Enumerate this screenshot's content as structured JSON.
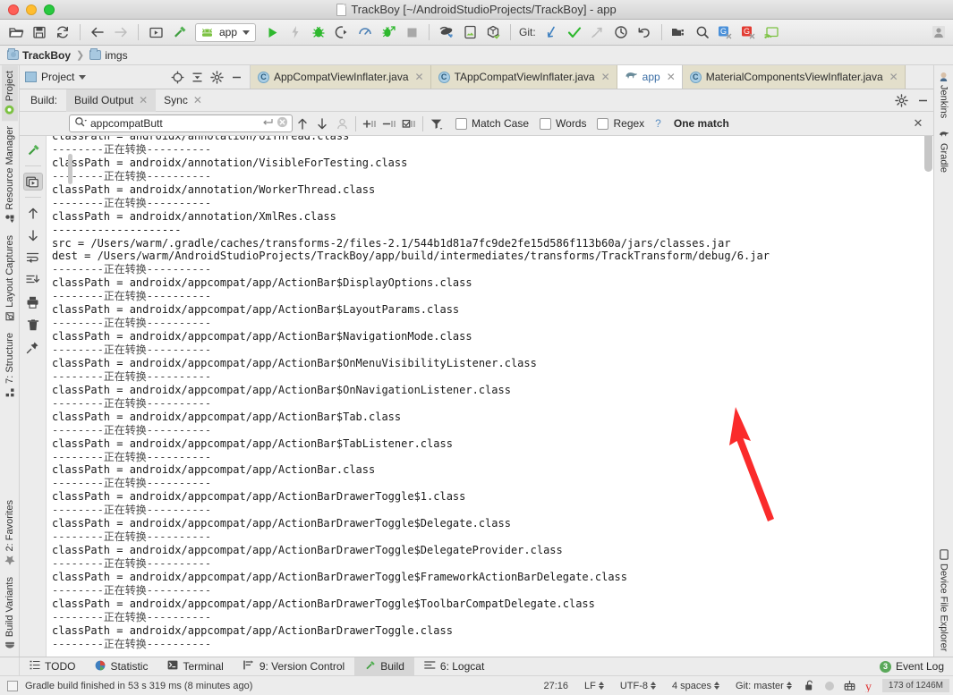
{
  "window": {
    "title": "TrackBoy [~/AndroidStudioProjects/TrackBoy] - app",
    "traffic_colors": {
      "close": "#ff5f57",
      "minimize": "#ffbd2e",
      "zoom": "#28c940"
    }
  },
  "toolbar": {
    "run_config": "app",
    "git_label": "Git:",
    "icons": [
      "open-folder-icon",
      "save-all-icon",
      "sync-icon",
      "back-arrow-icon",
      "forward-arrow-icon",
      "run-preview-icon",
      "build-hammer-icon"
    ],
    "run_icons": [
      "run-icon",
      "apply-changes-icon",
      "debug-icon",
      "attach-debugger-icon",
      "profiler-icon",
      "run-with-coverage-icon",
      "stop-icon"
    ],
    "device_icons": [
      "avd-manager-icon",
      "sdk-manager-icon",
      "device-manager-icon"
    ],
    "git_icons": [
      "update-project-icon",
      "commit-icon",
      "push-icon",
      "history-icon",
      "rollback-icon"
    ],
    "right_icons": [
      "project-structure-icon",
      "search-everywhere-icon",
      "translate-blue-icon",
      "translate-red-icon",
      "screen-cast-icon"
    ],
    "avatar_icon": "user-avatar-icon"
  },
  "breadcrumb": {
    "items": [
      "TrackBoy",
      "imgs"
    ]
  },
  "project_panel": {
    "title": "Project",
    "buttons": [
      "locate-icon",
      "collapse-all-icon",
      "settings-gear-icon",
      "hide-icon"
    ]
  },
  "editor_tabs": [
    {
      "label": "AppCompatViewInflater.java",
      "icon": "java-class-icon",
      "active": false
    },
    {
      "label": "TAppCompatViewInflater.java",
      "icon": "java-class-icon",
      "active": false
    },
    {
      "label": "app",
      "icon": "gradle-elephant-icon",
      "active": true
    },
    {
      "label": "MaterialComponentsViewInflater.java",
      "icon": "java-class-icon",
      "active": false
    }
  ],
  "build_panel": {
    "label": "Build:",
    "tabs": [
      {
        "label": "Build Output",
        "active": true
      },
      {
        "label": "Sync",
        "active": false
      }
    ],
    "header_buttons": [
      "settings-gear-icon",
      "hide-window-icon"
    ]
  },
  "find_bar": {
    "query": "appcompatButt",
    "placeholder": "",
    "nav_buttons": [
      "prev-occurrence-icon",
      "next-occurrence-icon",
      "select-all-occurrences-icon"
    ],
    "scope_buttons": [
      "add-line-icon",
      "remove-line-icon",
      "toggle-line-icon"
    ],
    "filter_button": "filter-icon",
    "checkboxes": [
      {
        "label": "Match Case",
        "checked": false
      },
      {
        "label": "Words",
        "checked": false
      },
      {
        "label": "Regex",
        "checked": false
      }
    ],
    "help": "?",
    "result": "One match",
    "close": "✕"
  },
  "gutter_buttons": [
    "build-hammer-icon",
    "restart-run-icon",
    "scroll-up-icon",
    "scroll-down-icon",
    "soft-wrap-icon",
    "scroll-to-end-icon",
    "print-icon",
    "clear-all-icon",
    "pin-icon"
  ],
  "console": {
    "separator": "--------正在转换----------",
    "dash_separator": "--------------------",
    "lines": [
      "classPath = androidx/annotation/UiThread.class",
      "--------正在转换----------",
      "classPath = androidx/annotation/VisibleForTesting.class",
      "--------正在转换----------",
      "classPath = androidx/annotation/WorkerThread.class",
      "--------正在转换----------",
      "classPath = androidx/annotation/XmlRes.class",
      "--------------------",
      "src = /Users/warm/.gradle/caches/transforms-2/files-2.1/544b1d81a7fc9de2fe15d586f113b60a/jars/classes.jar",
      "dest = /Users/warm/AndroidStudioProjects/TrackBoy/app/build/intermediates/transforms/TrackTransform/debug/6.jar",
      "--------正在转换----------",
      "classPath = androidx/appcompat/app/ActionBar$DisplayOptions.class",
      "--------正在转换----------",
      "classPath = androidx/appcompat/app/ActionBar$LayoutParams.class",
      "--------正在转换----------",
      "classPath = androidx/appcompat/app/ActionBar$NavigationMode.class",
      "--------正在转换----------",
      "classPath = androidx/appcompat/app/ActionBar$OnMenuVisibilityListener.class",
      "--------正在转换----------",
      "classPath = androidx/appcompat/app/ActionBar$OnNavigationListener.class",
      "--------正在转换----------",
      "classPath = androidx/appcompat/app/ActionBar$Tab.class",
      "--------正在转换----------",
      "classPath = androidx/appcompat/app/ActionBar$TabListener.class",
      "--------正在转换----------",
      "classPath = androidx/appcompat/app/ActionBar.class",
      "--------正在转换----------",
      "classPath = androidx/appcompat/app/ActionBarDrawerToggle$1.class",
      "--------正在转换----------",
      "classPath = androidx/appcompat/app/ActionBarDrawerToggle$Delegate.class",
      "--------正在转换----------",
      "classPath = androidx/appcompat/app/ActionBarDrawerToggle$DelegateProvider.class",
      "--------正在转换----------",
      "classPath = androidx/appcompat/app/ActionBarDrawerToggle$FrameworkActionBarDelegate.class",
      "--------正在转换----------",
      "classPath = androidx/appcompat/app/ActionBarDrawerToggle$ToolbarCompatDelegate.class",
      "--------正在转换----------",
      "classPath = androidx/appcompat/app/ActionBarDrawerToggle.class",
      "--------正在转换----------"
    ]
  },
  "annotation": {
    "arrow_color": "#fa2b2b",
    "points_to": "debug/6.jar"
  },
  "left_strip": [
    {
      "label": "Project",
      "icon": "project-icon",
      "active": true
    },
    {
      "label": "Resource Manager",
      "icon": "resource-manager-icon",
      "active": false
    },
    {
      "label": "Layout Captures",
      "icon": "layout-captures-icon",
      "active": false
    },
    {
      "label": "7: Structure",
      "icon": "structure-icon",
      "active": false
    },
    {
      "label": "2: Favorites",
      "icon": "star-icon",
      "active": false
    },
    {
      "label": "Build Variants",
      "icon": "build-variants-icon",
      "active": false
    }
  ],
  "right_strip": [
    {
      "label": "Jenkins",
      "icon": "jenkins-icon",
      "active": false
    },
    {
      "label": "Gradle",
      "icon": "gradle-elephant-icon",
      "active": false
    },
    {
      "label": "Device File Explorer",
      "icon": "device-file-explorer-icon",
      "active": false
    }
  ],
  "bottom_bar": {
    "tabs": [
      {
        "label": "TODO",
        "icon": "todo-icon",
        "active": false
      },
      {
        "label": "Statistic",
        "icon": "statistic-icon",
        "active": false
      },
      {
        "label": "Terminal",
        "icon": "terminal-icon",
        "active": false
      },
      {
        "label": "9: Version Control",
        "icon": "version-control-icon",
        "active": false
      },
      {
        "label": "Build",
        "icon": "build-hammer-icon",
        "active": true
      },
      {
        "label": "6: Logcat",
        "icon": "logcat-icon",
        "active": false
      }
    ],
    "event_log": {
      "label": "Event Log",
      "badge": "3"
    }
  },
  "status_bar": {
    "message": "Gradle build finished in 53 s 319 ms (8 minutes ago)",
    "caret": "27:16",
    "line_separator": "LF",
    "encoding": "UTF-8",
    "indent": "4 spaces",
    "branch": "Git: master",
    "memory": "173 of 1246M",
    "icons": [
      "lock-open-icon",
      "gray-sphere-icon",
      "keymap-icon",
      "yandex-icon"
    ]
  }
}
